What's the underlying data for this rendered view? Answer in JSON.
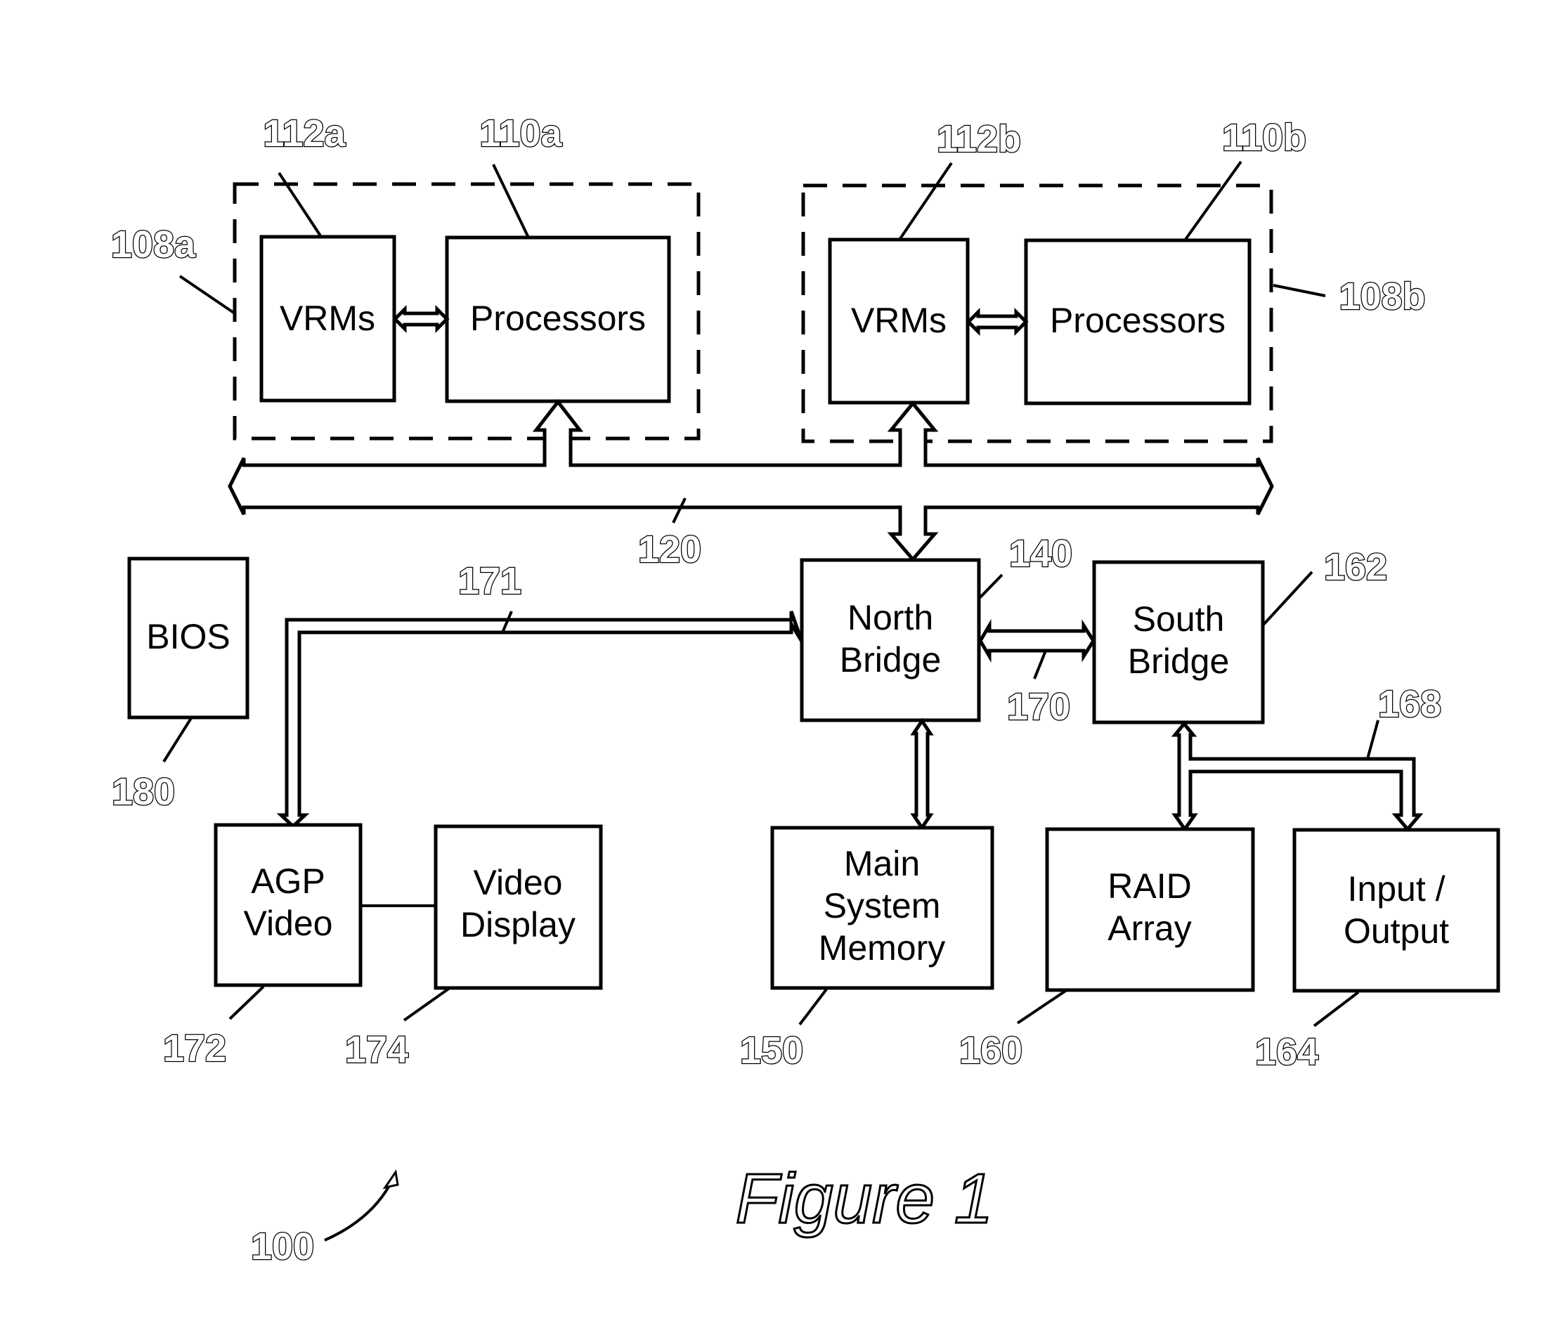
{
  "figure": {
    "title": "Figure 1",
    "system_ref": "100"
  },
  "blocks": {
    "vrms_a": {
      "lines": [
        "VRMs"
      ],
      "ref": "112a"
    },
    "proc_a": {
      "lines": [
        "Processors"
      ],
      "ref": "110a"
    },
    "group_a": {
      "ref": "108a"
    },
    "vrms_b": {
      "lines": [
        "VRMs"
      ],
      "ref": "112b"
    },
    "proc_b": {
      "lines": [
        "Processors"
      ],
      "ref": "110b"
    },
    "group_b": {
      "ref": "108b"
    },
    "bios": {
      "lines": [
        "BIOS"
      ],
      "ref": "180"
    },
    "north_bridge": {
      "lines": [
        "North",
        "Bridge"
      ],
      "ref": "140"
    },
    "south_bridge": {
      "lines": [
        "South",
        "Bridge"
      ],
      "ref": "162"
    },
    "agp_video": {
      "lines": [
        "AGP",
        "Video"
      ],
      "ref": "172"
    },
    "video_display": {
      "lines": [
        "Video",
        "Display"
      ],
      "ref": "174"
    },
    "main_memory": {
      "lines": [
        "Main",
        "System",
        "Memory"
      ],
      "ref": "150"
    },
    "raid_array": {
      "lines": [
        "RAID",
        "Array"
      ],
      "ref": "160"
    },
    "input_output": {
      "lines": [
        "Input /",
        "Output"
      ],
      "ref": "164"
    }
  },
  "buses": {
    "host_bus": {
      "ref": "120"
    },
    "agp_bus": {
      "ref": "171"
    },
    "hub_link": {
      "ref": "170"
    },
    "south_bus": {
      "ref": "168"
    }
  }
}
